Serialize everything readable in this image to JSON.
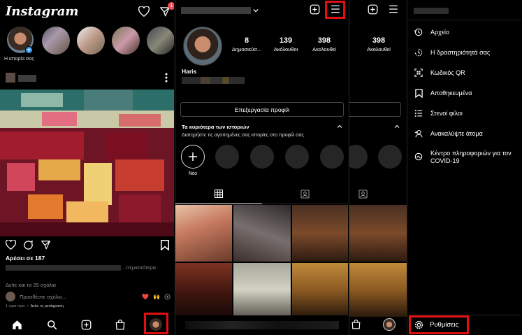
{
  "feed": {
    "logo": "Instagram",
    "notification_count": "1",
    "your_story_label": "Η ιστορία σας",
    "likes_text": "Αρέσει σε 187",
    "more_text": "...περισσότερα",
    "view_comments": "Δείτε και τα 25 σχόλια",
    "add_comment_placeholder": "Προσθέστε σχόλιο...",
    "time_text": "1 ώρα πριν",
    "see_translation": "Δείτε τη μετάφραση",
    "emoji_heart": "❤️",
    "emoji_hands": "🙌"
  },
  "profile": {
    "posts_count": "8",
    "posts_label": "Δημοσιεύσ...",
    "followers_count": "139",
    "followers_label": "Ακόλουθοι",
    "following_count": "398",
    "following_label": "Ακολουθεί",
    "name": "Haris",
    "edit_profile": "Επεξεργασία προφίλ",
    "highlights_title": "Τα κυριότερα των ιστοριών",
    "highlights_subtitle": "Διατηρήστε τις αγαπημένες σας ιστορίες στο προφίλ σας",
    "new_label": "Νέο"
  },
  "menu": {
    "items": [
      {
        "label": "Αρχείο",
        "icon": "archive-icon"
      },
      {
        "label": "Η δραστηριότητά σας",
        "icon": "activity-icon"
      },
      {
        "label": "Κωδικός QR",
        "icon": "qr-icon"
      },
      {
        "label": "Αποθηκευμένα",
        "icon": "bookmark-icon"
      },
      {
        "label": "Στενοί φίλοι",
        "icon": "close-friends-icon"
      },
      {
        "label": "Ανακαλύψτε άτομα",
        "icon": "add-person-icon"
      },
      {
        "label": "Κέντρο πληροφοριών για τον COVID-19",
        "icon": "covid-icon"
      }
    ],
    "settings_label": "Ρυθμίσεις"
  },
  "colors": {
    "accent_red": "#e01010",
    "badge": "#ed4956",
    "link_blue": "#3897f0"
  }
}
